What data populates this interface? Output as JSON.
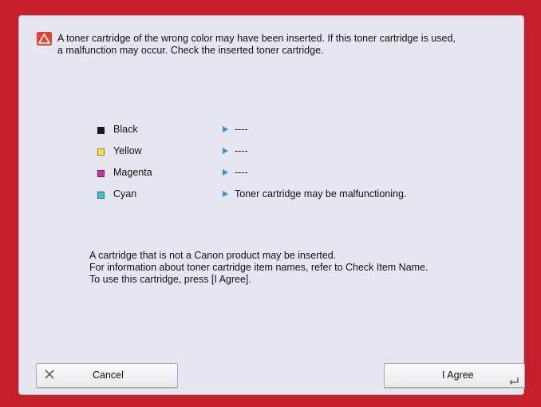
{
  "message": {
    "icon": "warning-icon",
    "line1": "A toner cartridge of the wrong color may have been inserted. If this toner cartridge is used,",
    "line2": "a malfunction may occur. Check the inserted toner cartridge."
  },
  "colors": [
    {
      "name": "Black",
      "status": "----",
      "swatch": "#1a1a1a"
    },
    {
      "name": "Yellow",
      "status": "----",
      "swatch": "#f2e43a"
    },
    {
      "name": "Magenta",
      "status": "----",
      "swatch": "#c0399a"
    },
    {
      "name": "Cyan",
      "status": "Toner cartridge may be malfunctioning.",
      "swatch": "#3fc0d0"
    }
  ],
  "info": {
    "line1": "A cartridge that is not a Canon product may be inserted.",
    "line2": "For information about toner cartridge item names, refer to Check Item Name.",
    "line3": "To use this cartridge, press [I Agree]."
  },
  "buttons": {
    "cancel_label": "Cancel",
    "cancel_icon": "close-icon",
    "agree_label": "I Agree",
    "agree_icon": "enter-icon"
  },
  "colors_theme": {
    "background": "#c8202b",
    "dialog": "#e6e6f0",
    "warning": "#e8412f",
    "arrow": "#3c8fd8"
  }
}
